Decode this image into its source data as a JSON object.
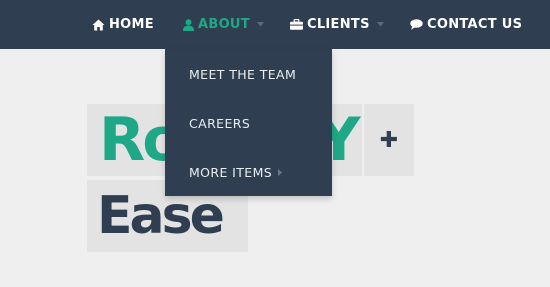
{
  "nav": {
    "home": "HOME",
    "about": "ABOUT",
    "clients": "CLIENTS",
    "contact": "CONTACT US"
  },
  "dropdown": {
    "items": [
      "MEET THE TEAM",
      "CAREERS",
      "MORE ITEMS"
    ]
  },
  "hero": {
    "line1": "Ro",
    "line1_tail": "Y",
    "plus": "✚",
    "line2": "Ease"
  },
  "colors": {
    "nav_bg": "#2f3e51",
    "accent": "#1fa888",
    "page_bg": "#f0eff0",
    "block_bg": "#e3e3e3"
  },
  "icons": {
    "home": "home-icon",
    "about": "user-icon",
    "clients": "briefcase-icon",
    "contact": "speech-bubble-icon"
  }
}
